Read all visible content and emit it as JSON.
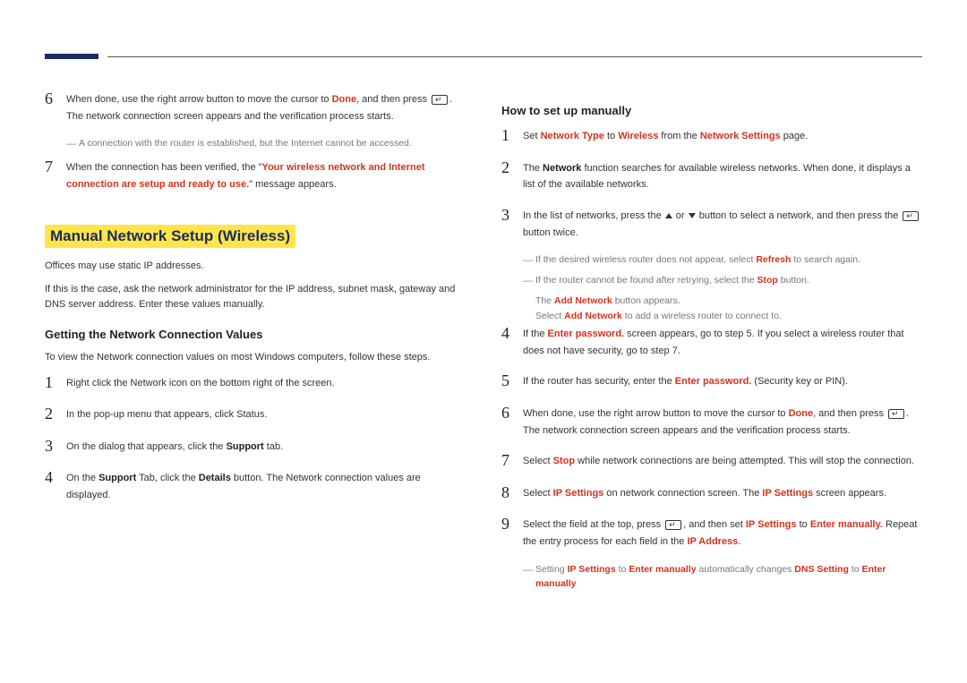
{
  "left": {
    "step6_a": "When done, use the right arrow button to move the cursor to ",
    "step6_done": "Done",
    "step6_b": ", and then press ",
    "step6_c": ". The network connection screen appears and the verification process starts.",
    "note1": "A connection with the router is established, but the Internet cannot be accessed.",
    "step7_a": "When the connection has been verified, the \"",
    "step7_red": "Your wireless network and Internet connection are setup and ready to use.",
    "step7_b": "\" message appears.",
    "section_title": "Manual Network Setup (Wireless)",
    "para1": "Offices may use static IP addresses.",
    "para2": "If this is the case, ask the network administrator for the IP address, subnet mask, gateway and DNS server address. Enter these values manually.",
    "sub1": "Getting the Network Connection Values",
    "sub1_intro": "To view the Network connection values on most Windows computers, follow these steps.",
    "gs1": "Right click the Network icon on the bottom right of the screen.",
    "gs2": "In the pop-up menu that appears, click Status.",
    "gs3_a": "On the dialog that appears, click the ",
    "gs3_b": "Support",
    "gs3_c": " tab.",
    "gs4_a": "On the ",
    "gs4_b": "Support",
    "gs4_c": " Tab, click the ",
    "gs4_d": "Details",
    "gs4_e": " button. The Network connection values are displayed."
  },
  "right": {
    "sub": "How to set up manually",
    "s1_a": "Set ",
    "s1_b": "Network Type",
    "s1_c": " to ",
    "s1_d": "Wireless",
    "s1_e": " from the ",
    "s1_f": "Network Settings",
    "s1_g": " page.",
    "s2_a": "The ",
    "s2_b": "Network",
    "s2_c": " function searches for available wireless networks. When done, it displays a list of the available networks.",
    "s3_a": "In the list of networks, press the ",
    "s3_b": " or ",
    "s3_c": " button to select a network, and then press the ",
    "s3_d": " button twice.",
    "n3a_a": "If the desired wireless router does not appear, select ",
    "n3a_b": "Refresh",
    "n3a_c": " to search again.",
    "n3b_a": "If the router cannot be found after retrying, select the ",
    "n3b_b": "Stop",
    "n3b_c": " button.",
    "n3c_a": "The ",
    "n3c_b": "Add Network",
    "n3c_c": " button appears.",
    "n3d_a": "Select ",
    "n3d_b": "Add Network",
    "n3d_c": " to add a wireless router to connect to.",
    "s4_a": "If the ",
    "s4_b": "Enter password.",
    "s4_c": " screen appears, go to step 5. If you select a wireless router that does not have security, go to step 7.",
    "s5_a": "If the router has security, enter the ",
    "s5_b": "Enter password.",
    "s5_c": " (Security key or PIN).",
    "s6_a": "When done, use the right arrow button to move the cursor to ",
    "s6_b": "Done",
    "s6_c": ", and then press ",
    "s6_d": ". The network connection screen appears and the verification process starts.",
    "s7_a": "Select ",
    "s7_b": "Stop",
    "s7_c": " while network connections are being attempted. This will stop the connection.",
    "s8_a": "Select ",
    "s8_b": "IP Settings",
    "s8_c": " on network connection screen. The ",
    "s8_d": "IP Settings",
    "s8_e": " screen appears.",
    "s9_a": "Select the field at the top, press ",
    "s9_b": ", and then set ",
    "s9_c": "IP Settings",
    "s9_d": " to ",
    "s9_e": "Enter manually.",
    "s9_f": " Repeat the entry process for each field in the ",
    "s9_g": "IP Address",
    "s9_h": ".",
    "n9_a": "Setting ",
    "n9_b": "IP Settings",
    "n9_c": " to ",
    "n9_d": "Enter manually",
    "n9_e": " automatically changes ",
    "n9_f": "DNS Setting",
    "n9_g": " to ",
    "n9_h": "Enter manually"
  }
}
